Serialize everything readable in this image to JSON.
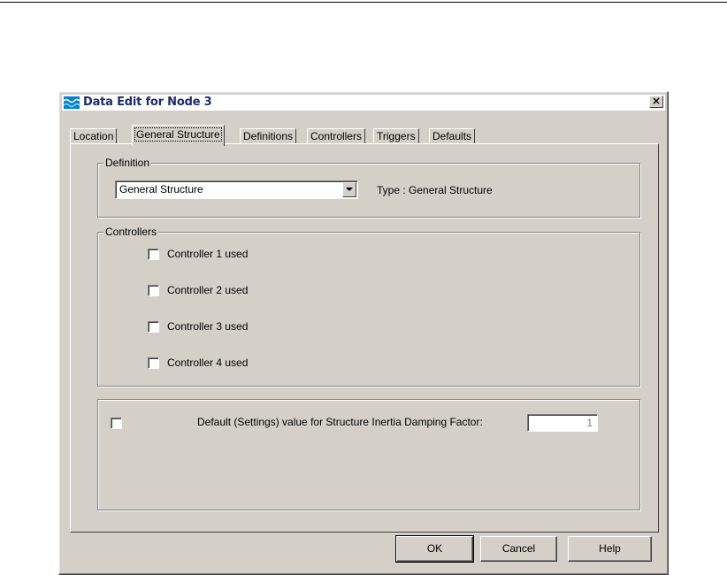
{
  "window": {
    "title": "Data Edit for Node 3",
    "close_label": "×"
  },
  "tabs": [
    {
      "label": "Location"
    },
    {
      "label": "General Structure",
      "active": true
    },
    {
      "label": "Definitions"
    },
    {
      "label": "Controllers"
    },
    {
      "label": "Triggers"
    },
    {
      "label": "Defaults"
    }
  ],
  "definition": {
    "group_label": "Definition",
    "selected": "General Structure",
    "type_text": "Type :  General Structure"
  },
  "controllers": {
    "group_label": "Controllers",
    "items": [
      {
        "label": "Controller 1 used",
        "checked": false
      },
      {
        "label": "Controller 2 used",
        "checked": false
      },
      {
        "label": "Controller 3 used",
        "checked": false
      },
      {
        "label": "Controller 4 used",
        "checked": false
      }
    ]
  },
  "damping": {
    "checked": false,
    "label": "Default (Settings) value for Structure Inertia Damping Factor:",
    "value": "1"
  },
  "buttons": {
    "ok": "OK",
    "cancel": "Cancel",
    "help": "Help"
  },
  "colors": {
    "dialog_bg": "#d4d0c8",
    "title_text": "#1c2c6c"
  }
}
